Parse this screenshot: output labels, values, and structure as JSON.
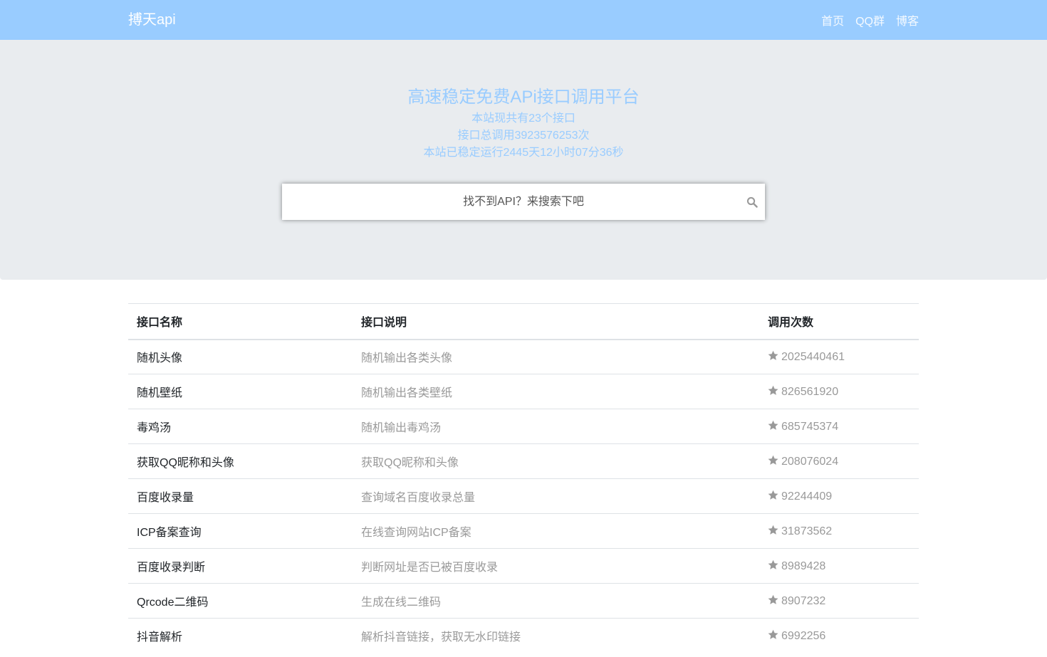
{
  "navbar": {
    "brand": "搏天api",
    "links": [
      "首页",
      "QQ群",
      "博客"
    ]
  },
  "hero": {
    "title": "高速稳定免费APi接口调用平台",
    "stat_count": "本站现共有23个接口",
    "stat_calls": "接口总调用3923576253次",
    "stat_uptime": "本站已稳定运行2445天12小时07分36秒"
  },
  "search": {
    "placeholder": "找不到API？来搜索下吧",
    "icon": "search-icon"
  },
  "table": {
    "headers": [
      "接口名称",
      "接口说明",
      "调用次数"
    ],
    "count_icon": "star-icon",
    "rows": [
      {
        "name": "随机头像",
        "desc": "随机输出各类头像",
        "count": "2025440461"
      },
      {
        "name": "随机壁纸",
        "desc": "随机输出各类壁纸",
        "count": "826561920"
      },
      {
        "name": "毒鸡汤",
        "desc": "随机输出毒鸡汤",
        "count": "685745374"
      },
      {
        "name": "获取QQ昵称和头像",
        "desc": "获取QQ昵称和头像",
        "count": "208076024"
      },
      {
        "name": "百度收录量",
        "desc": "查询域名百度收录总量",
        "count": "92244409"
      },
      {
        "name": "ICP备案查询",
        "desc": "在线查询网站ICP备案",
        "count": "31873562"
      },
      {
        "name": "百度收录判断",
        "desc": "判断网址是否已被百度收录",
        "count": "8989428"
      },
      {
        "name": "Qrcode二维码",
        "desc": "生成在线二维码",
        "count": "8907232"
      },
      {
        "name": "抖音解析",
        "desc": "解析抖音链接，获取无水印链接",
        "count": "6992256"
      }
    ]
  },
  "colors": {
    "navbar_bg": "#99ccff",
    "hero_bg": "#e9ecef",
    "hero_text": "#99ccff",
    "muted_text": "#999999"
  }
}
